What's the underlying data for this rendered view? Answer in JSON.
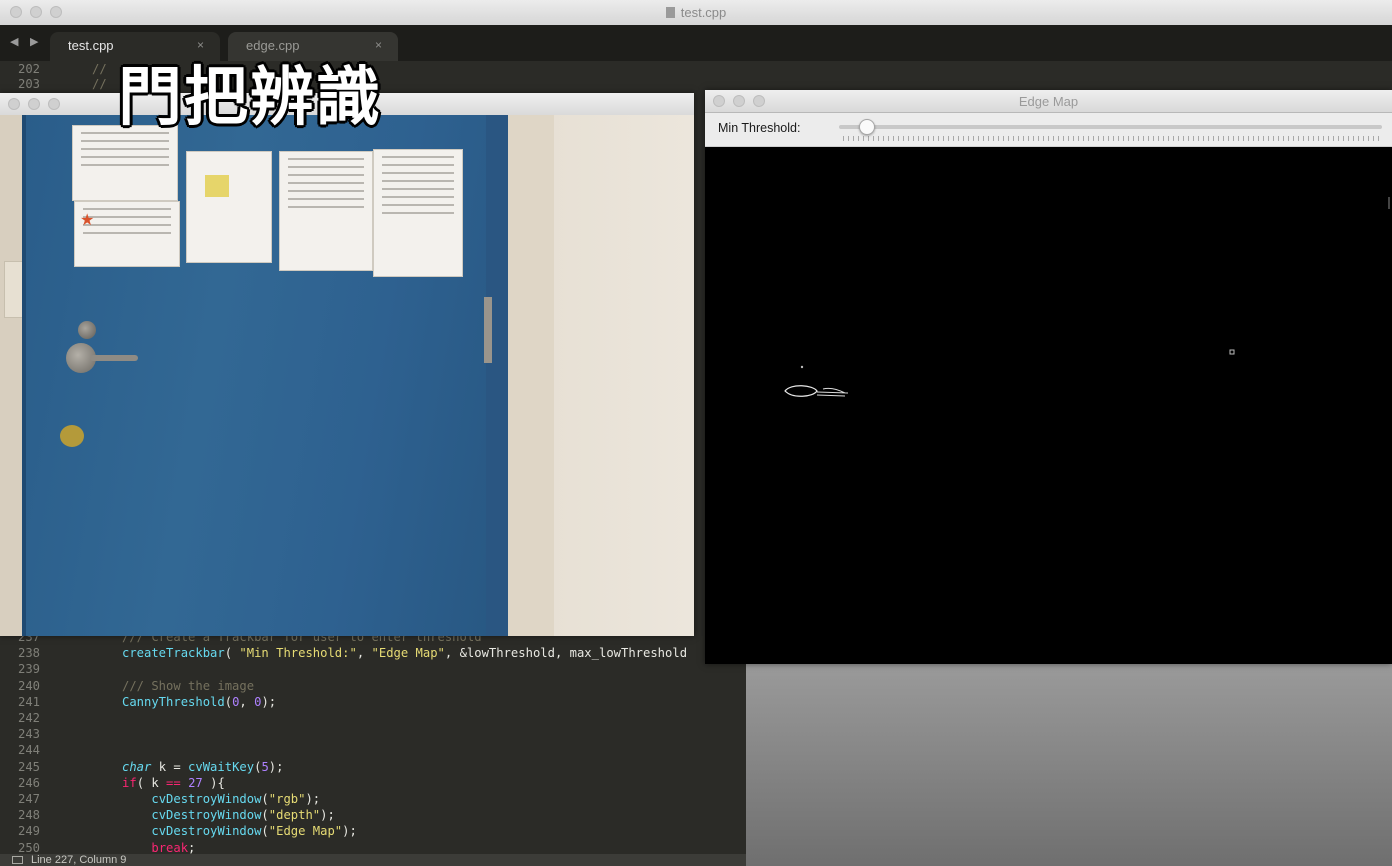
{
  "editor_window": {
    "title": "test.cpp",
    "tabs": [
      {
        "label": "test.cpp",
        "close": "×"
      },
      {
        "label": "edge.cpp",
        "close": "×"
      }
    ],
    "nav_arrows": "◀ ▶"
  },
  "code_top": [
    {
      "ln": "202",
      "text": "// "
    },
    {
      "ln": "203",
      "text": "// "
    }
  ],
  "code_bottom": [
    {
      "ln": "237",
      "parts": [
        {
          "t": "/// Create a Trackbar for user to enter threshold",
          "c": "c"
        }
      ]
    },
    {
      "ln": "238",
      "parts": [
        {
          "t": "createTrackbar",
          "c": "fn"
        },
        {
          "t": "( ",
          "c": ""
        },
        {
          "t": "\"Min Threshold:\"",
          "c": "str"
        },
        {
          "t": ", ",
          "c": ""
        },
        {
          "t": "\"Edge Map\"",
          "c": "str"
        },
        {
          "t": ", &lowThreshold, max_lowThreshold",
          "c": ""
        }
      ]
    },
    {
      "ln": "239",
      "parts": []
    },
    {
      "ln": "240",
      "parts": [
        {
          "t": "/// Show the image",
          "c": "c"
        }
      ]
    },
    {
      "ln": "241",
      "parts": [
        {
          "t": "CannyThreshold",
          "c": "fn"
        },
        {
          "t": "(",
          "c": ""
        },
        {
          "t": "0",
          "c": "num"
        },
        {
          "t": ", ",
          "c": ""
        },
        {
          "t": "0",
          "c": "num"
        },
        {
          "t": ");",
          "c": ""
        }
      ]
    },
    {
      "ln": "242",
      "parts": []
    },
    {
      "ln": "243",
      "parts": []
    },
    {
      "ln": "244",
      "parts": []
    },
    {
      "ln": "245",
      "parts": [
        {
          "t": "char",
          "c": "ty"
        },
        {
          "t": " k = ",
          "c": ""
        },
        {
          "t": "cvWaitKey",
          "c": "fn"
        },
        {
          "t": "(",
          "c": ""
        },
        {
          "t": "5",
          "c": "num"
        },
        {
          "t": ");",
          "c": ""
        }
      ]
    },
    {
      "ln": "246",
      "parts": [
        {
          "t": "if",
          "c": "kw"
        },
        {
          "t": "( k ",
          "c": ""
        },
        {
          "t": "==",
          "c": "kw"
        },
        {
          "t": " ",
          "c": ""
        },
        {
          "t": "27",
          "c": "num"
        },
        {
          "t": " ){",
          "c": ""
        }
      ]
    },
    {
      "ln": "247",
      "parts": [
        {
          "t": "    ",
          "c": ""
        },
        {
          "t": "cvDestroyWindow",
          "c": "fn"
        },
        {
          "t": "(",
          "c": ""
        },
        {
          "t": "\"rgb\"",
          "c": "str"
        },
        {
          "t": ");",
          "c": ""
        }
      ]
    },
    {
      "ln": "248",
      "parts": [
        {
          "t": "    ",
          "c": ""
        },
        {
          "t": "cvDestroyWindow",
          "c": "fn"
        },
        {
          "t": "(",
          "c": ""
        },
        {
          "t": "\"depth\"",
          "c": "str"
        },
        {
          "t": ");",
          "c": ""
        }
      ]
    },
    {
      "ln": "249",
      "parts": [
        {
          "t": "    ",
          "c": ""
        },
        {
          "t": "cvDestroyWindow",
          "c": "fn"
        },
        {
          "t": "(",
          "c": ""
        },
        {
          "t": "\"Edge Map\"",
          "c": "str"
        },
        {
          "t": ");",
          "c": ""
        }
      ]
    },
    {
      "ln": "250",
      "parts": [
        {
          "t": "    ",
          "c": ""
        },
        {
          "t": "break",
          "c": "kw"
        },
        {
          "t": ";",
          "c": ""
        }
      ]
    }
  ],
  "status_bar": {
    "position": "Line 227, Column 9"
  },
  "subtitle": "門把辨識",
  "edge_map_window": {
    "title": "Edge Map",
    "trackbar_label": "Min Threshold:",
    "trackbar_value_fraction": 0.05
  },
  "icons": {
    "tab_close": "close-icon",
    "status_panel": "panel-toggle-icon"
  },
  "colors": {
    "editor_bg": "#2b2b27",
    "comment": "#75715e",
    "function": "#66d9ef",
    "string": "#e6db74",
    "keyword": "#f92672",
    "number": "#ae81ff",
    "door_blue": "#326894"
  }
}
